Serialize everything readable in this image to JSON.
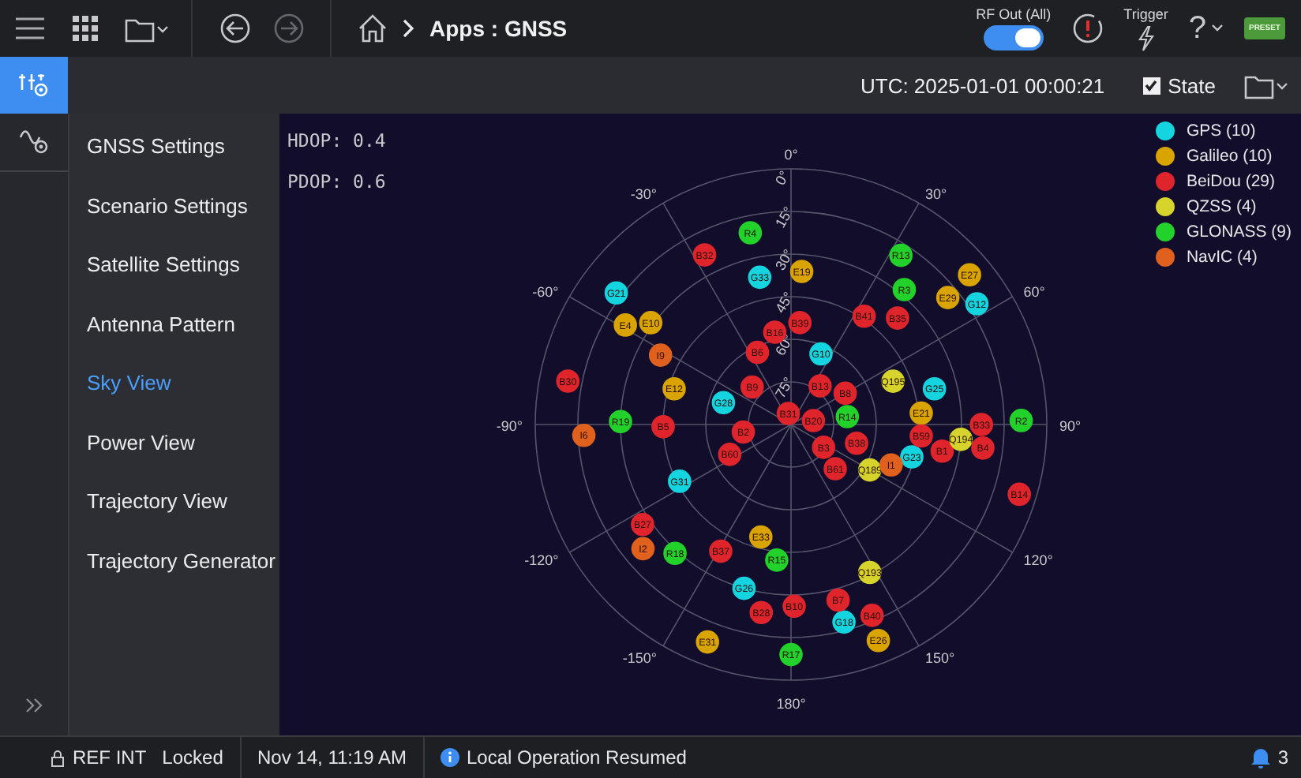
{
  "top_bar": {
    "title": "Apps : GNSS",
    "rf_out": {
      "label": "RF Out (All)",
      "on": true
    },
    "trigger": {
      "label": "Trigger"
    },
    "help": {
      "label": "?"
    },
    "preset": {
      "label": "PRESET"
    }
  },
  "header": {
    "utc": "UTC: 2025-01-01 00:00:21",
    "state": {
      "label": "State",
      "checked": true
    }
  },
  "sidebar": {
    "items": [
      {
        "label": "GNSS Settings",
        "selected": false
      },
      {
        "label": "Scenario Settings",
        "selected": false
      },
      {
        "label": "Satellite Settings",
        "selected": false
      },
      {
        "label": "Antenna Pattern",
        "selected": false
      },
      {
        "label": "Sky View",
        "selected": true
      },
      {
        "label": "Power View",
        "selected": false
      },
      {
        "label": "Trajectory View",
        "selected": false
      },
      {
        "label": "Trajectory Generator",
        "selected": false
      }
    ]
  },
  "plot": {
    "hdop": "HDOP: 0.4",
    "pdop": "PDOP: 0.6",
    "azimuth_labels": [
      "0°",
      "30°",
      "60°",
      "90°",
      "120°",
      "150°",
      "180°",
      "-150°",
      "-120°",
      "-90°",
      "-60°",
      "-30°"
    ],
    "elevation_labels": [
      "0°",
      "15°",
      "30°",
      "45°",
      "60°",
      "75°"
    ],
    "constellations": [
      {
        "name": "GPS (10)",
        "color": "#14d4e0",
        "satellites": [
          "G33",
          "G21",
          "G10",
          "G12",
          "G28",
          "G25",
          "G31",
          "G26",
          "G18",
          "G23"
        ]
      },
      {
        "name": "Galileo (10)",
        "color": "#d9a300",
        "satellites": [
          "E19",
          "E27",
          "E29",
          "E4",
          "E10",
          "E12",
          "E21",
          "E33",
          "E31",
          "E26"
        ]
      },
      {
        "name": "BeiDou (29)",
        "color": "#e0242c",
        "satellites": [
          "B32",
          "B39",
          "B41",
          "B35",
          "B16",
          "B6",
          "B30",
          "B9",
          "B31",
          "B13",
          "B8",
          "B5",
          "B2",
          "B60",
          "B20",
          "B3",
          "B61",
          "B38",
          "B59",
          "B1",
          "B33",
          "B4",
          "B14",
          "B27",
          "B37",
          "B28",
          "B10",
          "B7",
          "B40"
        ]
      },
      {
        "name": "QZSS (4)",
        "color": "#d6d42c",
        "satellites": [
          "Q195",
          "Q189",
          "Q194",
          "Q193"
        ]
      },
      {
        "name": "GLONASS (9)",
        "color": "#22d12a",
        "satellites": [
          "R4",
          "R13",
          "R3",
          "R19",
          "R14",
          "R2",
          "R18",
          "R15",
          "R17"
        ]
      },
      {
        "name": "NavIC (4)",
        "color": "#e0601e",
        "satellites": [
          "I9",
          "I6",
          "I2",
          "I1"
        ]
      }
    ]
  },
  "status_bar": {
    "reference": "REF INT",
    "lock": "Locked",
    "time": "Nov 14, 11:19 AM",
    "message": "Local Operation Resumed",
    "notifications": "3"
  }
}
